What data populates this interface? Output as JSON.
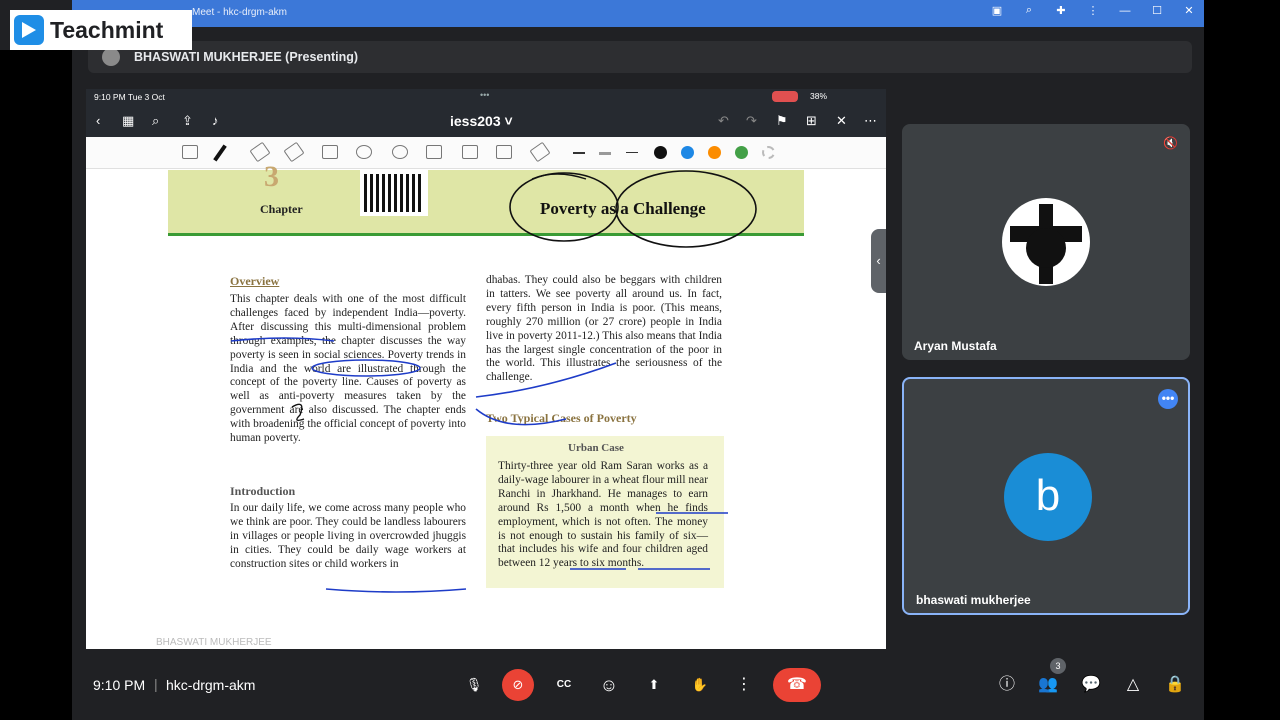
{
  "chrome": {
    "title": "Meet - hkc-drgm-akm"
  },
  "brand": {
    "name": "Teachmint"
  },
  "presenting": {
    "label": "BHASWATI MUKHERJEE (Presenting)"
  },
  "shared_screen": {
    "status_time": "9:10 PM  Tue 3 Oct",
    "status_dots": "•••",
    "battery": "38%",
    "doc_title": "iess203 ˅",
    "colors": [
      "#111111",
      "#1e88e5",
      "#fb8c00",
      "#43a047",
      "#1e88e5"
    ],
    "page": {
      "chapter_number": "3",
      "chapter_label": "Chapter",
      "chapter_title": "Poverty as a Challenge",
      "overview_heading": "Overview",
      "overview_text": "This chapter deals with one of the most difficult challenges faced by independent India—poverty. After discussing this multi-dimensional problem through examples, the chapter discusses the way poverty is seen in social sciences. Poverty trends in India and the world are illustrated through the concept of the poverty line. Causes of poverty as well as anti-poverty measures taken by the government are also discussed. The chapter ends with broadening the official concept of poverty into human poverty.",
      "intro_heading": "Introduction",
      "intro_text": "In our daily life, we come across many people who we think are poor. They could be landless labourers in villages or people living in overcrowded jhuggis in cities. They could be daily wage workers at construction sites or child workers in",
      "right_text": "dhabas. They could also be beggars with children in tatters. We see poverty all around us. In fact, every fifth person in India is poor. (This means, roughly 270 million (or 27 crore) people in India live in poverty 2011-12.) This also means that India has the largest single concentration of the poor in the world. This illustrates the seriousness of the challenge.",
      "cases_heading": "Two Typical Cases of Poverty",
      "case_title": "Urban Case",
      "case_text": "Thirty-three year old Ram Saran works as a daily-wage labourer in a wheat flour mill near Ranchi in Jharkhand. He manages to earn around Rs 1,500 a month when he finds employment, which is not often. The money is not enough to sustain his family of six—that includes his wife and four children aged between 12 years to six months.",
      "watermark": "BHASWATI MUKHERJEE"
    }
  },
  "participants": [
    {
      "name": "Aryan Mustafa",
      "muted": true
    },
    {
      "name": "bhaswati mukherjee",
      "initial": "b"
    }
  ],
  "meeting": {
    "time": "9:10 PM",
    "separator": "|",
    "code": "hkc-drgm-akm",
    "participant_count": "3"
  },
  "icons": {
    "mic": "🎙",
    "camera_off": "⊘",
    "captions": "CC",
    "emoji": "☺",
    "present": "⬆",
    "hand": "✋",
    "more": "⋮",
    "end_call": "☎",
    "info": "ⓘ",
    "people": "👥",
    "chat": "💬",
    "activities": "△",
    "host_controls": "🔒"
  }
}
